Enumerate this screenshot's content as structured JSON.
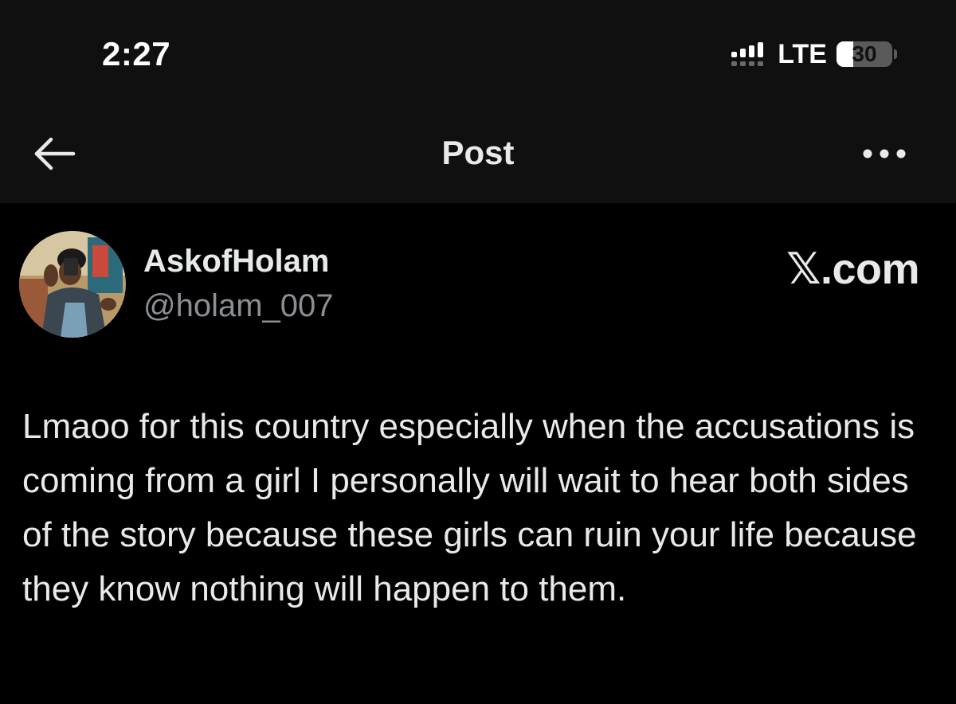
{
  "status_bar": {
    "time": "2:27",
    "network": "LTE",
    "battery_level": "30"
  },
  "nav": {
    "back_icon": "arrow-left-icon",
    "title": "Post",
    "more_icon": "more-horizontal-icon"
  },
  "post": {
    "author": {
      "display_name": "AskofHolam",
      "handle": "@holam_007"
    },
    "watermark": "𝕏.com",
    "text": "Lmaoo for this country especially when the accusations is coming from a girl I personally will wait to hear both sides of the story because these girls can ruin your life because they know nothing will happen to them."
  },
  "colors": {
    "background": "#000000",
    "header_bg": "#101010",
    "text_primary": "#e7e9ea",
    "text_secondary": "#8b8f94"
  }
}
